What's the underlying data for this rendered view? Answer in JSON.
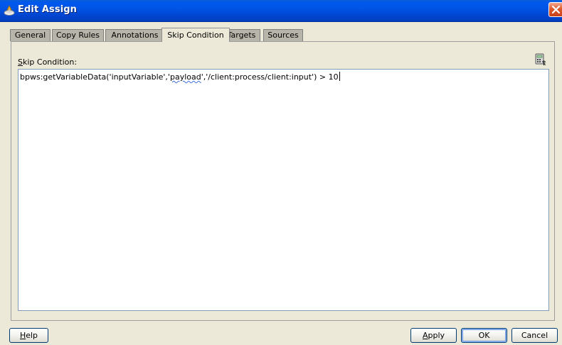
{
  "window": {
    "title": "Edit Assign",
    "title_icon": "assign-icon",
    "close_icon": "close-icon"
  },
  "tabs": [
    {
      "label": "General",
      "active": false
    },
    {
      "label": "Copy Rules",
      "active": false
    },
    {
      "label": "Annotations",
      "active": false
    },
    {
      "label": "Skip Condition",
      "active": true
    },
    {
      "label": "Targets",
      "active": false
    },
    {
      "label": "Sources",
      "active": false
    }
  ],
  "skip_condition": {
    "label_mnemonic": "S",
    "label_rest": "kip Condition:",
    "expression_before": "bpws:getVariableData('inputVariable','",
    "expression_underlined": "payload",
    "expression_after": "','/client:process/client:input') > 10",
    "expression_builder_icon": "calculator-icon"
  },
  "buttons": {
    "help_mnemonic": "H",
    "help_rest": "elp",
    "apply_mnemonic": "A",
    "apply_rest": "pply",
    "ok": "OK",
    "cancel": "Cancel"
  },
  "colors": {
    "titlebar": "#0055e5",
    "dialog_bg": "#ece9d8",
    "close_button": "#e05a2b",
    "tab_inactive": "#b7b5a9"
  }
}
